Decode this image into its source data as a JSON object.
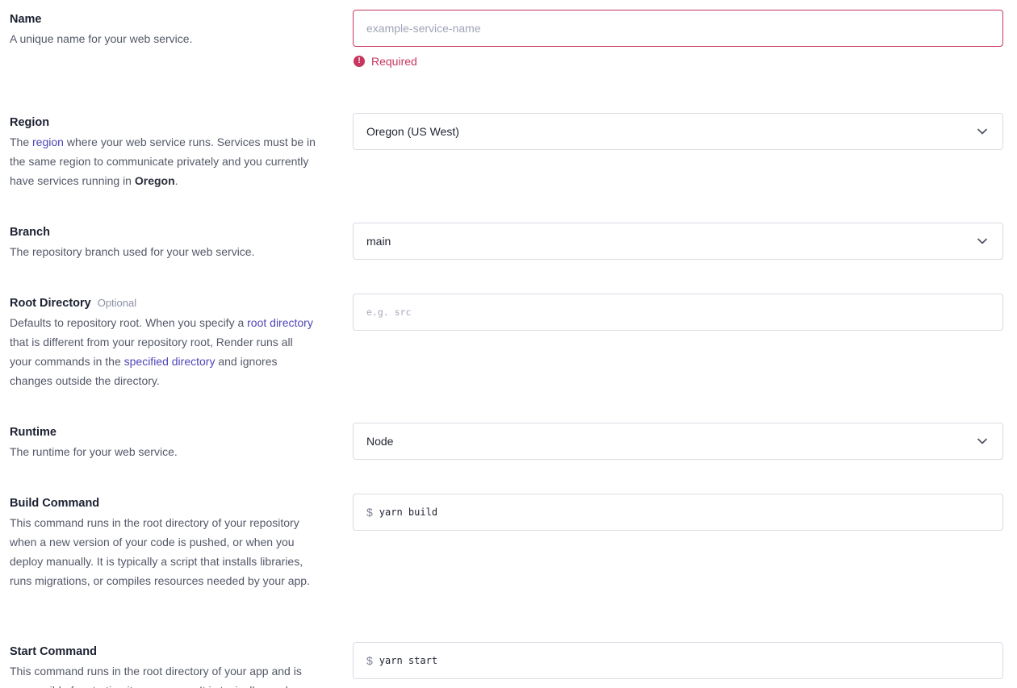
{
  "name_field": {
    "title": "Name",
    "description": "A unique name for your web service.",
    "placeholder": "example-service-name",
    "error": "Required"
  },
  "region_field": {
    "title": "Region",
    "desc_prefix": "The ",
    "desc_link": "region",
    "desc_middle": " where your web service runs. Services must be in the same region to communicate privately and you currently have services running in ",
    "desc_bold": "Oregon",
    "desc_suffix": ".",
    "value": "Oregon (US West)"
  },
  "branch_field": {
    "title": "Branch",
    "description": "The repository branch used for your web service.",
    "value": "main"
  },
  "root_dir_field": {
    "title": "Root Directory",
    "optional_label": "Optional",
    "desc_part1": "Defaults to repository root. When you specify a ",
    "desc_link1": "root directory",
    "desc_part2": " that is different from your repository root, Render runs all your commands in the ",
    "desc_link2": "specified directory",
    "desc_part3": " and ignores changes outside the directory.",
    "placeholder": "e.g. src"
  },
  "runtime_field": {
    "title": "Runtime",
    "description": "The runtime for your web service.",
    "value": "Node"
  },
  "build_field": {
    "title": "Build Command",
    "description": "This command runs in the root directory of your repository when a new version of your code is pushed, or when you deploy manually. It is typically a script that installs libraries, runs migrations, or compiles resources needed by your app.",
    "prompt": "$",
    "value": "yarn build"
  },
  "start_field": {
    "title": "Start Command",
    "description": "This command runs in the root directory of your app and is responsible for starting its processes. It is typically used",
    "prompt": "$",
    "value": "yarn start"
  },
  "colors": {
    "error": "#c7365f",
    "link": "#4f46b8",
    "border": "#d9dce3"
  },
  "icons": {
    "select": "chevron-down-icon",
    "error": "alert-circle-icon"
  }
}
